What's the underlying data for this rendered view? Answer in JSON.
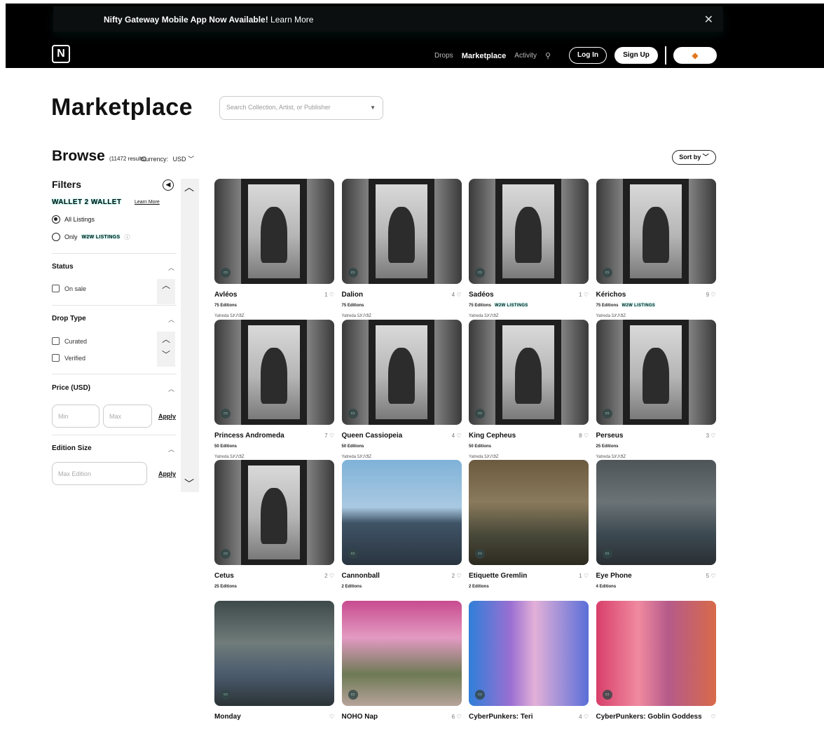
{
  "announcement": {
    "bold": "Nifty Gateway Mobile App Now Available!",
    "link": "Learn More",
    "close": "✕"
  },
  "header": {
    "logo": "N",
    "nav": [
      "Drops",
      "Marketplace",
      "Activity"
    ],
    "active_nav": "Marketplace",
    "login": "Log In",
    "signup": "Sign Up",
    "wallet_icon": "fox-icon"
  },
  "page": {
    "title": "Marketplace",
    "search_placeholder": "Search Collection, Artist, or Publisher",
    "browse": "Browse",
    "results": "(11472 results)",
    "currency_label": "Currency:",
    "currency_value": "USD",
    "sort": "Sort by"
  },
  "filters": {
    "title": "Filters",
    "w2w_title": "WALLET 2 WALLET",
    "learn_more": "Learn More",
    "radio_all": "All Listings",
    "radio_only": "Only",
    "w2w_badge": "W2W LISTINGS",
    "status_title": "Status",
    "on_sale": "On sale",
    "drop_type_title": "Drop Type",
    "curated": "Curated",
    "verified": "Verified",
    "price_title": "Price (USD)",
    "min_placeholder": "Min",
    "max_placeholder": "Max",
    "apply": "Apply",
    "edition_title": "Edition Size",
    "edition_placeholder": "Max Edition"
  },
  "cards": [
    {
      "name": "Avléos",
      "likes": "1",
      "editions": "75 Editions",
      "w2w": "",
      "artist": "Yatreda ᏚᎩᏁᏕᏃ"
    },
    {
      "name": "Dalion",
      "likes": "4",
      "editions": "75 Editions",
      "w2w": "",
      "artist": "Yatreda ᏚᎩᏁᏕᏃ"
    },
    {
      "name": "Sadéos",
      "likes": "1",
      "editions": "75 Editions",
      "w2w": "W2W LISTINGS",
      "artist": "Yatreda ᏚᎩᏁᏕᏃ"
    },
    {
      "name": "Kérichos",
      "likes": "9",
      "editions": "75 Editions",
      "w2w": "W2W LISTINGS",
      "artist": "Yatreda ᏚᎩᏁᏕᏃ"
    },
    {
      "name": "Princess Andromeda",
      "likes": "7",
      "editions": "50 Editions",
      "w2w": "",
      "artist": "Yatreda ᏚᎩᏁᏕᏃ"
    },
    {
      "name": "Queen Cassiopeia",
      "likes": "4",
      "editions": "50 Editions",
      "w2w": "",
      "artist": "Yatreda ᏚᎩᏁᏕᏃ"
    },
    {
      "name": "King Cepheus",
      "likes": "8",
      "editions": "50 Editions",
      "w2w": "",
      "artist": "Yatreda ᏚᎩᏁᏕᏃ"
    },
    {
      "name": "Perseus",
      "likes": "3",
      "editions": "25 Editions",
      "w2w": "",
      "artist": "Yatreda ᏚᎩᏁᏕᏃ"
    },
    {
      "name": "Cetus",
      "likes": "2",
      "editions": "25 Editions",
      "w2w": "",
      "artist": ""
    },
    {
      "name": "Cannonball",
      "likes": "2",
      "editions": "2 Editions",
      "w2w": "",
      "artist": ""
    },
    {
      "name": "Etiquette Gremlin",
      "likes": "1",
      "editions": "2 Editions",
      "w2w": "",
      "artist": ""
    },
    {
      "name": "Eye Phone",
      "likes": "5",
      "editions": "4 Editions",
      "w2w": "",
      "artist": ""
    },
    {
      "name": "Monday",
      "likes": "",
      "editions": "",
      "w2w": "",
      "artist": ""
    },
    {
      "name": "NOHO Nap",
      "likes": "6",
      "editions": "",
      "w2w": "",
      "artist": ""
    },
    {
      "name": "CyberPunkers: Teri",
      "likes": "4",
      "editions": "",
      "w2w": "",
      "artist": ""
    },
    {
      "name": "CyberPunkers: Goblin Goddess",
      "likes": "",
      "editions": "",
      "w2w": "",
      "artist": ""
    }
  ],
  "colors": {
    "w2w_glow": "#35e5d2",
    "header_bg": "#000000"
  }
}
